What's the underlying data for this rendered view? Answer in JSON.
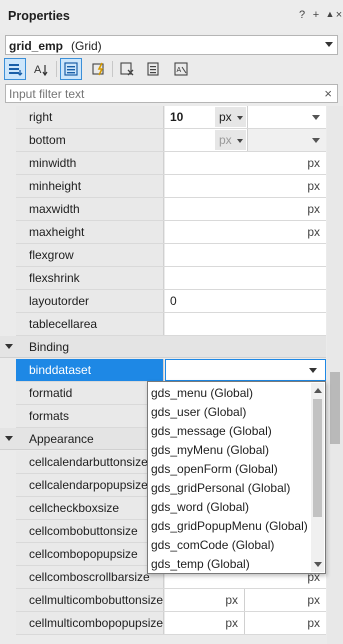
{
  "title": "Properties",
  "title_buttons": [
    "?",
    "+",
    "▲",
    "×"
  ],
  "object_selector": {
    "name": "grid_emp",
    "type": "(Grid)"
  },
  "toolbar_buttons": [
    {
      "name": "categorized-icon",
      "active": true
    },
    {
      "name": "sort-alpha-icon",
      "active": false
    },
    {
      "name": "properties-icon",
      "active": true
    },
    {
      "name": "events-icon",
      "active": false
    },
    {
      "name": "user-property-icon",
      "active": false
    },
    {
      "name": "delete-property-icon",
      "active": false
    },
    {
      "name": "script-icon",
      "active": false
    }
  ],
  "filter": {
    "placeholder": "Input filter text",
    "value": ""
  },
  "rows_top": [
    {
      "label": "right",
      "value": "10",
      "unit": "px",
      "kind": "unit-combo"
    },
    {
      "label": "bottom",
      "value": "",
      "unit": "px",
      "kind": "unit-combo-dim"
    },
    {
      "label": "minwidth",
      "value": "",
      "unit": "px",
      "kind": "px"
    },
    {
      "label": "minheight",
      "value": "",
      "unit": "px",
      "kind": "px"
    },
    {
      "label": "maxwidth",
      "value": "",
      "unit": "px",
      "kind": "px"
    },
    {
      "label": "maxheight",
      "value": "",
      "unit": "px",
      "kind": "px"
    },
    {
      "label": "flexgrow",
      "value": "",
      "unit": "",
      "kind": "plain"
    },
    {
      "label": "flexshrink",
      "value": "",
      "unit": "",
      "kind": "plain"
    },
    {
      "label": "layoutorder",
      "value": "0",
      "unit": "",
      "kind": "plain"
    },
    {
      "label": "tablecellarea",
      "value": "",
      "unit": "",
      "kind": "plain"
    }
  ],
  "binding_category": "Binding",
  "binding_rows": [
    {
      "label": "binddataset",
      "selected": true
    },
    {
      "label": "formatid",
      "selected": false
    },
    {
      "label": "formats",
      "selected": false
    }
  ],
  "appearance_category": "Appearance",
  "appearance_rows": [
    {
      "label": "cellcalendarbuttonsize",
      "kind": "px"
    },
    {
      "label": "cellcalendarpopupsize",
      "kind": "px"
    },
    {
      "label": "cellcheckboxsize",
      "kind": "px"
    },
    {
      "label": "cellcombobuttonsize",
      "kind": "px"
    },
    {
      "label": "cellcombopopupsize",
      "kind": "px"
    },
    {
      "label": "cellcomboscrollbarsize",
      "kind": "px"
    },
    {
      "label": "cellmulticombobuttonsize",
      "kind": "px2"
    },
    {
      "label": "cellmulticombopopupsize",
      "kind": "px2"
    }
  ],
  "dataset_options": [
    "gds_menu (Global)",
    "gds_user (Global)",
    "gds_message (Global)",
    "gds_myMenu (Global)",
    "gds_openForm (Global)",
    "gds_gridPersonal (Global)",
    "gds_word (Global)",
    "gds_gridPopupMenu (Global)",
    "gds_comCode (Global)",
    "gds_temp (Global)"
  ],
  "colors": {
    "selection": "#1e88e5",
    "label_bg": "#e9e9e9",
    "category_bg": "#e4e4e4"
  }
}
